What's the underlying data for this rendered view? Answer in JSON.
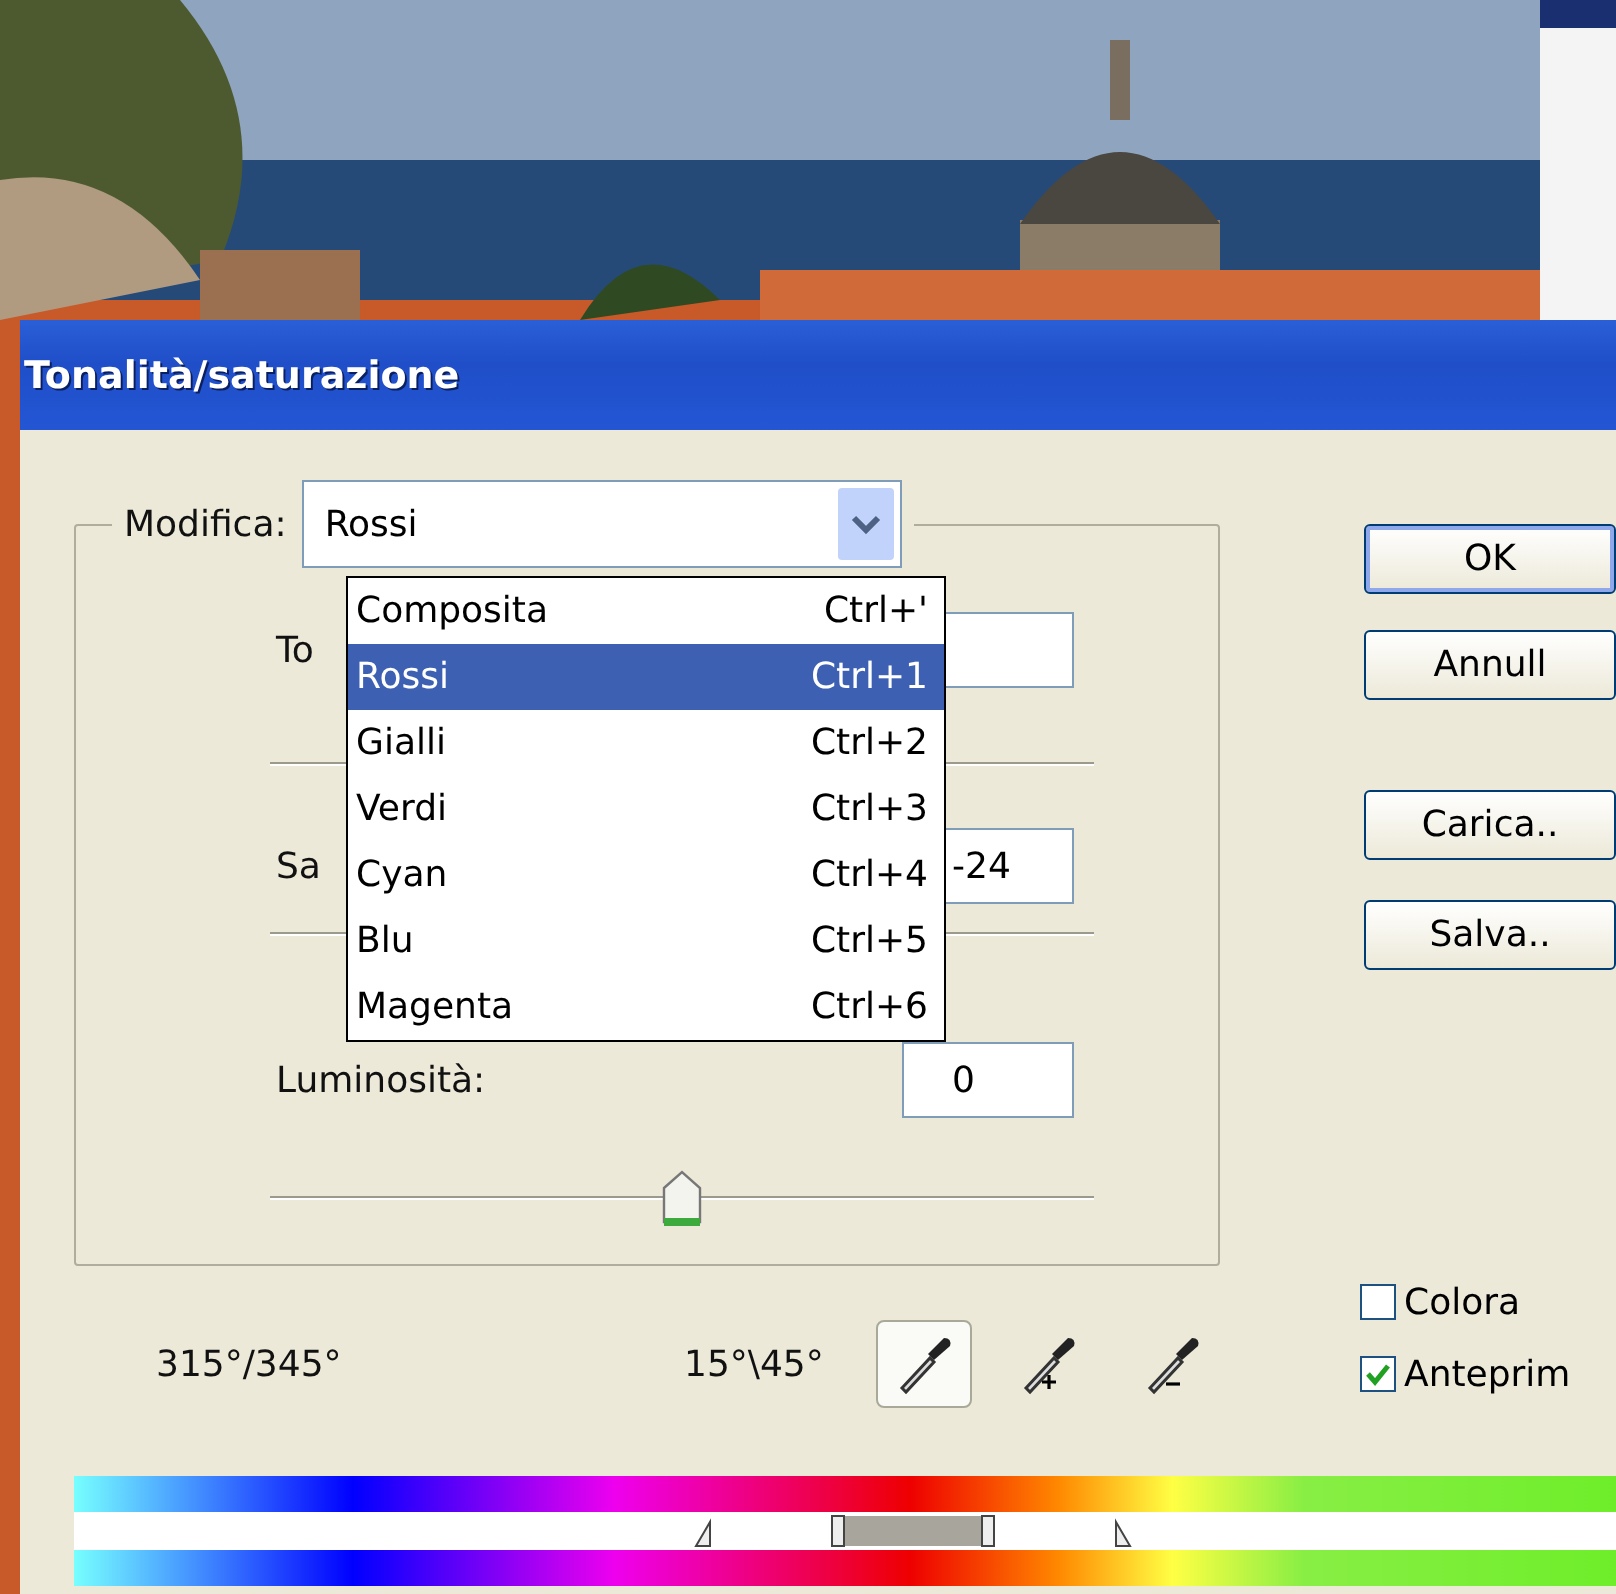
{
  "window": {
    "title": "Tonalità/saturazione"
  },
  "edit": {
    "label": "Modifica:",
    "value": "Rossi",
    "expanded": true,
    "options": [
      {
        "label": "Composita",
        "shortcut": "Ctrl+'",
        "selected": false
      },
      {
        "label": "Rossi",
        "shortcut": "Ctrl+1",
        "selected": true
      },
      {
        "label": "Gialli",
        "shortcut": "Ctrl+2",
        "selected": false
      },
      {
        "label": "Verdi",
        "shortcut": "Ctrl+3",
        "selected": false
      },
      {
        "label": "Cyan",
        "shortcut": "Ctrl+4",
        "selected": false
      },
      {
        "label": "Blu",
        "shortcut": "Ctrl+5",
        "selected": false
      },
      {
        "label": "Magenta",
        "shortcut": "Ctrl+6",
        "selected": false
      }
    ]
  },
  "adjustments": [
    {
      "label": "To"
    },
    {
      "label": "Sa",
      "value": "-24"
    },
    {
      "label": "Luminosità:",
      "value": "0",
      "level": 0.5
    }
  ],
  "range": {
    "left": "315°/345°",
    "right": "15°\\45°"
  },
  "eyedroppers": [
    {
      "kind": "plain",
      "selected": true
    },
    {
      "kind": "add",
      "selected": false
    },
    {
      "kind": "subtract",
      "selected": false
    }
  ],
  "buttons": [
    "OK",
    "Annull",
    "Carica..",
    "Salva.."
  ],
  "checkboxes": [
    {
      "label": "Colora",
      "checked": false
    },
    {
      "label": "Anteprim",
      "checked": true
    }
  ]
}
